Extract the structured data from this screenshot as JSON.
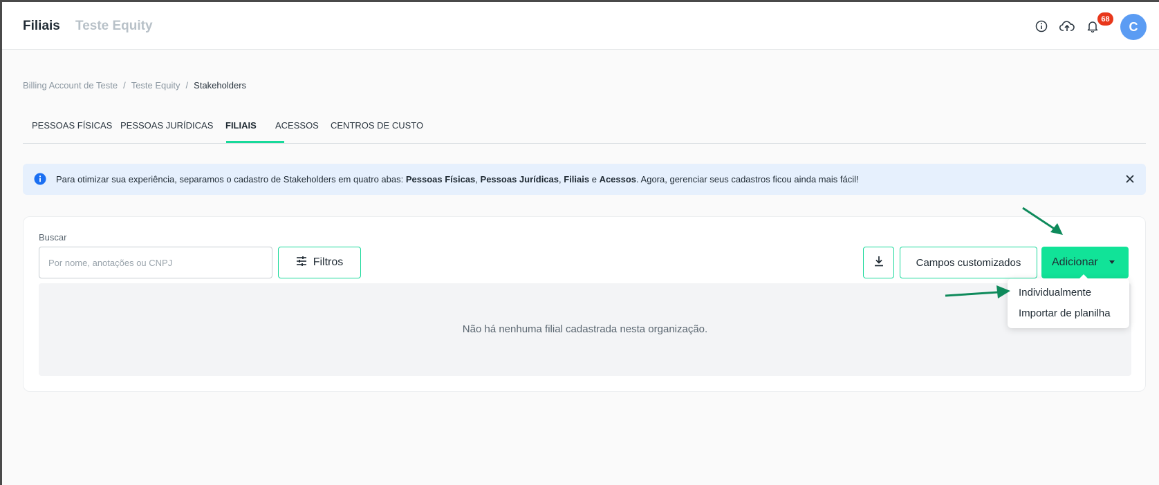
{
  "header": {
    "title": "Filiais",
    "subtitle": "Teste Equity",
    "notification_count": "68",
    "avatar_initial": "C",
    "icons": [
      "info-circle-icon",
      "cloud-upload-icon",
      "bell-icon"
    ]
  },
  "breadcrumb": {
    "items": [
      "Billing Account de Teste",
      "Teste Equity"
    ],
    "separator": "/",
    "current": "Stakeholders"
  },
  "tabs": {
    "items": [
      {
        "label": "PESSOAS FÍSICAS"
      },
      {
        "label": "PESSOAS JURÍDICAS"
      },
      {
        "label": "FILIAIS"
      },
      {
        "label": "ACESSOS"
      },
      {
        "label": "CENTROS DE CUSTO"
      }
    ],
    "active": "FILIAIS"
  },
  "banner": {
    "text_before": "Para otimizar sua experiência, separamos o cadastro de Stakeholders em quatro abas: ",
    "bold1": "Pessoas Físicas",
    "sep1": ", ",
    "bold2": "Pessoas Jurídicas",
    "sep2": ", ",
    "bold3": "Filiais",
    "sep3": " e ",
    "bold4": "Acessos",
    "text_after": ". Agora, gerenciar seus cadastros ficou ainda mais fácil!"
  },
  "search": {
    "label": "Buscar",
    "value": "",
    "placeholder": "Por nome, anotações ou CNPJ"
  },
  "toolbar": {
    "filters_label": "Filtros",
    "custom_fields_label": "Campos customizados",
    "add_label": "Adicionar"
  },
  "add_menu": {
    "items": [
      "Individualmente",
      "Importar de planilha"
    ]
  },
  "empty_state": {
    "message": "Não há nenhuma filial cadastrada nesta organização."
  },
  "colors": {
    "accent": "#11e398",
    "badge": "#e8371b",
    "avatar": "#5b9cf3",
    "banner_bg": "#e6f0fd",
    "annotation_arrow": "#0e8a5b"
  }
}
